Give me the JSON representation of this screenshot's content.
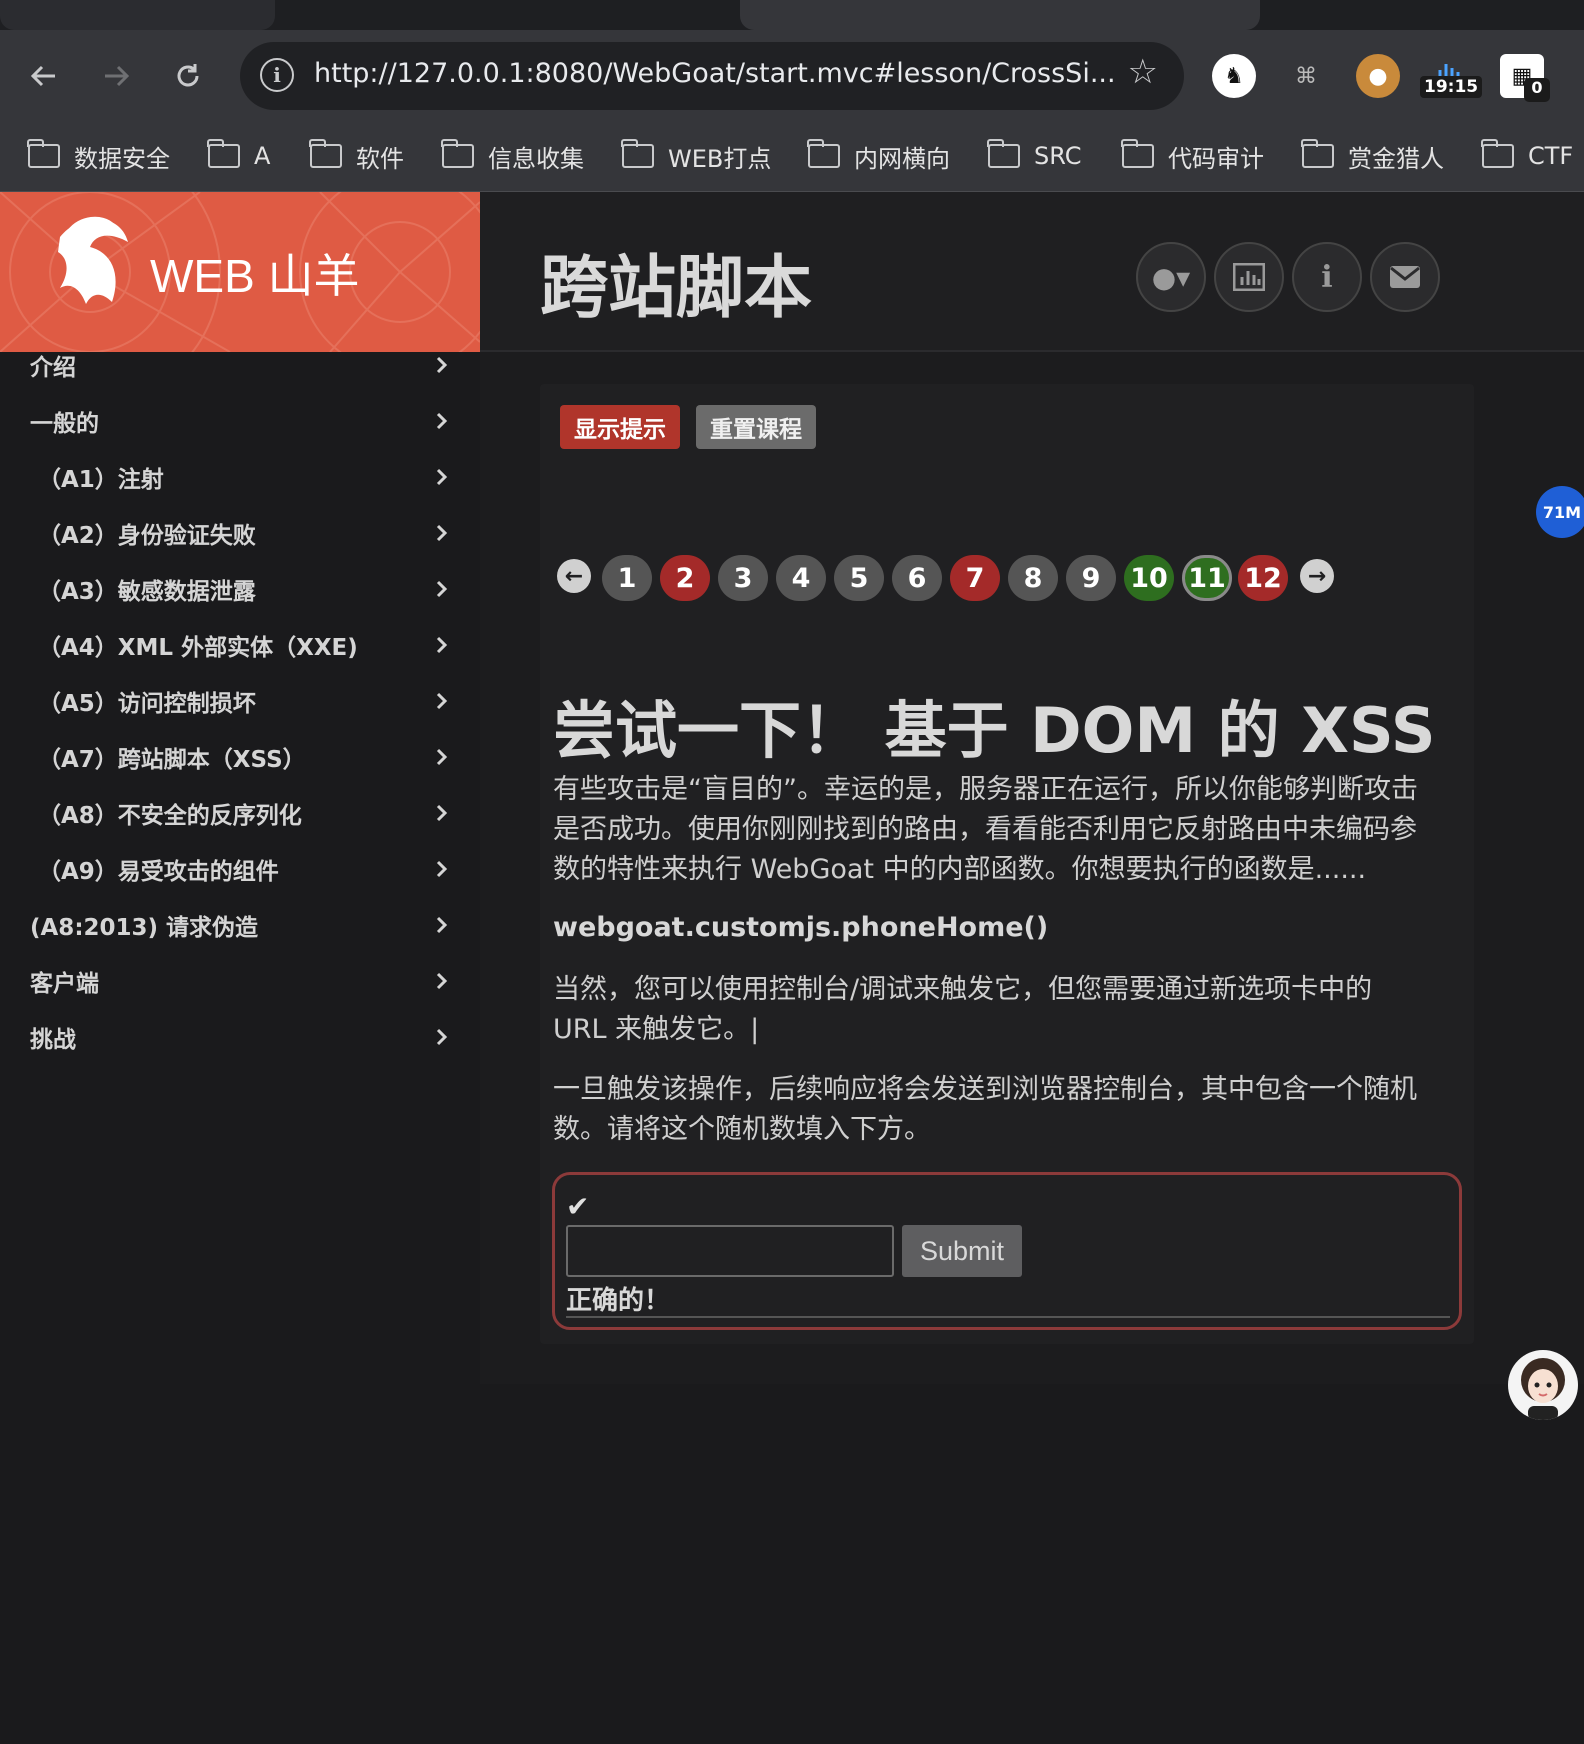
{
  "browser": {
    "url": "http://127.0.0.1:8080/WebGoat/start.mvc#lesson/CrossSi...",
    "clock": "19:15",
    "badge": "0",
    "bookmarks": [
      "数据安全",
      "A",
      "软件",
      "信息收集",
      "WEB打点",
      "内网横向",
      "SRC",
      "代码审计",
      "赏金猎人",
      "CTF"
    ]
  },
  "app": {
    "brand": "WEB 山羊",
    "page_title": "跨站脚本",
    "header_buttons": [
      "user-menu",
      "report-card",
      "about",
      "contact"
    ]
  },
  "sidebar": {
    "items": [
      {
        "label": "介绍"
      },
      {
        "label": "一般的"
      },
      {
        "label": "（A1）注射"
      },
      {
        "label": "（A2）身份验证失败"
      },
      {
        "label": "（A3）敏感数据泄露"
      },
      {
        "label": "（A4）XML 外部实体（XXE)"
      },
      {
        "label": "（A5）访问控制损坏"
      },
      {
        "label": "（A7）跨站脚本（XSS）"
      },
      {
        "label": "（A8）不安全的反序列化"
      },
      {
        "label": "（A9）易受攻击的组件"
      },
      {
        "label": "(A8:2013) 请求伪造"
      },
      {
        "label": "客户端"
      },
      {
        "label": "挑战"
      }
    ]
  },
  "lesson": {
    "show_hints": "显示提示",
    "reset_lesson": "重置课程",
    "pages": [
      {
        "n": "1",
        "status": "gray"
      },
      {
        "n": "2",
        "status": "red"
      },
      {
        "n": "3",
        "status": "gray"
      },
      {
        "n": "4",
        "status": "gray"
      },
      {
        "n": "5",
        "status": "gray"
      },
      {
        "n": "6",
        "status": "gray"
      },
      {
        "n": "7",
        "status": "red"
      },
      {
        "n": "8",
        "status": "gray"
      },
      {
        "n": "9",
        "status": "gray"
      },
      {
        "n": "10",
        "status": "green"
      },
      {
        "n": "11",
        "status": "active"
      },
      {
        "n": "12",
        "status": "red"
      }
    ],
    "heading": "尝试一下！ 基于 DOM 的 XSS",
    "para1_lines": [
      "有些攻击是“盲目的”。幸运的是，服务器正在运行，所以你能够判断攻击",
      "是否成功。使用你刚刚找到的路由，看看能否利用它反射路由中未编码参",
      "数的特性来执行 WebGoat 中的内部函数。你想要执行的函数是......"
    ],
    "code": "webgoat.customjs.phoneHome()",
    "para2_lines": [
      "当然，您可以使用控制台/调试来触发它，但您需要通过新选项卡中的",
      "URL 来触发它。|"
    ],
    "para3_lines": [
      "一旦触发该操作，后续响应将会发送到浏览器控制台，其中包含一个随机",
      "数。请将这个随机数填入下方。"
    ],
    "answer_value": "",
    "submit": "Submit",
    "feedback": "正确的！"
  },
  "overlay": {
    "chip": "71M"
  }
}
